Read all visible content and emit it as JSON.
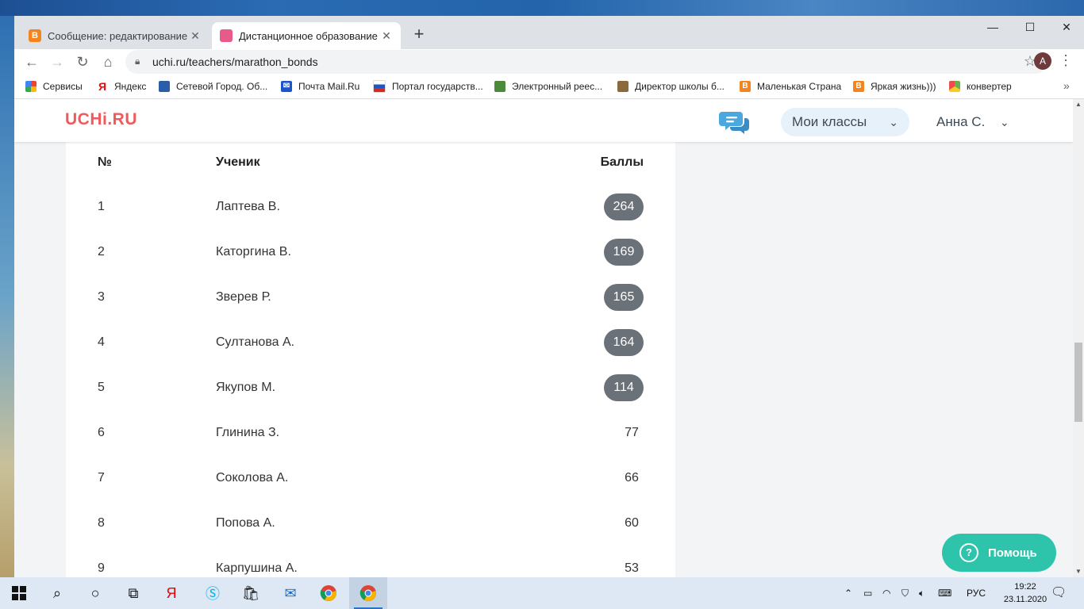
{
  "browser": {
    "tabs": [
      {
        "title": "Сообщение: редактирование",
        "favicon_color": "#f4841e"
      },
      {
        "title": "Дистанционное образование д",
        "favicon_color": "#e85a8a"
      }
    ],
    "url": "uchi.ru/teachers/marathon_bonds",
    "profile_initial": "A",
    "bookmarks": [
      {
        "label": "Сервисы",
        "icon": "apps-grid-icon",
        "color": "#e8453c"
      },
      {
        "label": "Яндекс",
        "icon": "yandex-icon",
        "color": "#ff0000"
      },
      {
        "label": "Сетевой Город. Об...",
        "icon": "netcity-icon",
        "color": "#2b5ea8"
      },
      {
        "label": "Почта Mail.Ru",
        "icon": "mail-icon",
        "color": "#1a55c9"
      },
      {
        "label": "Портал государств...",
        "icon": "gosuslugi-icon",
        "color": "#d52b1e"
      },
      {
        "label": "Электронный реес...",
        "icon": "registry-icon",
        "color": "#4a8a3a"
      },
      {
        "label": "Директор школы б...",
        "icon": "director-icon",
        "color": "#8a6a3a"
      },
      {
        "label": "Маленькая Страна",
        "icon": "blogger-icon",
        "color": "#f4841e"
      },
      {
        "label": "Яркая жизнь)))",
        "icon": "blogger-icon",
        "color": "#f4841e"
      },
      {
        "label": "конвертер",
        "icon": "converter-icon",
        "color": "#6ab04c"
      }
    ]
  },
  "site": {
    "logo": "UCHi.RU",
    "classes_label": "Мои классы",
    "user_name": "Анна С.",
    "help_label": "Помощь",
    "help_glyph": "?"
  },
  "table": {
    "headers": {
      "num": "№",
      "student": "Ученик",
      "score": "Баллы"
    },
    "rows": [
      {
        "num": "1",
        "name": "Лаптева В.",
        "score": "264",
        "highlight": true
      },
      {
        "num": "2",
        "name": "Каторгина В.",
        "score": "169",
        "highlight": true
      },
      {
        "num": "3",
        "name": "Зверев Р.",
        "score": "165",
        "highlight": true
      },
      {
        "num": "4",
        "name": "Султанова А.",
        "score": "164",
        "highlight": true
      },
      {
        "num": "5",
        "name": "Якупов М.",
        "score": "114",
        "highlight": true
      },
      {
        "num": "6",
        "name": "Глинина З.",
        "score": "77",
        "highlight": false
      },
      {
        "num": "7",
        "name": "Соколова А.",
        "score": "66",
        "highlight": false
      },
      {
        "num": "8",
        "name": "Попова А.",
        "score": "60",
        "highlight": false
      },
      {
        "num": "9",
        "name": "Карпушина А.",
        "score": "53",
        "highlight": false
      }
    ]
  },
  "taskbar": {
    "language": "РУС",
    "time": "19:22",
    "date": "23.11.2020"
  },
  "colors": {
    "logo": "#f05a5a",
    "pill": "#6b7178",
    "help": "#2ec4ab",
    "classes_bg": "#e6f1fa"
  }
}
